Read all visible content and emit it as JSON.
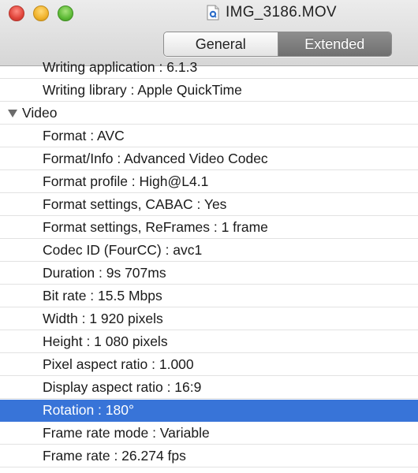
{
  "window": {
    "title": "IMG_3186.MOV",
    "file_icon": "quicktime-document-icon"
  },
  "tabs": {
    "general_label": "General",
    "extended_label": "Extended",
    "selected": "Extended"
  },
  "rows": [
    {
      "kind": "prop",
      "text": "Writing application : 6.1.3"
    },
    {
      "kind": "prop",
      "text": "Writing library : Apple QuickTime"
    },
    {
      "kind": "section",
      "text": "Video"
    },
    {
      "kind": "prop",
      "text": "Format : AVC"
    },
    {
      "kind": "prop",
      "text": "Format/Info : Advanced Video Codec"
    },
    {
      "kind": "prop",
      "text": "Format profile : High@L4.1"
    },
    {
      "kind": "prop",
      "text": "Format settings, CABAC : Yes"
    },
    {
      "kind": "prop",
      "text": "Format settings, ReFrames : 1 frame"
    },
    {
      "kind": "prop",
      "text": "Codec ID (FourCC) : avc1"
    },
    {
      "kind": "prop",
      "text": "Duration : 9s 707ms"
    },
    {
      "kind": "prop",
      "text": "Bit rate : 15.5 Mbps"
    },
    {
      "kind": "prop",
      "text": "Width : 1 920 pixels"
    },
    {
      "kind": "prop",
      "text": "Height : 1 080 pixels"
    },
    {
      "kind": "prop",
      "text": "Pixel aspect ratio : 1.000"
    },
    {
      "kind": "prop",
      "text": "Display aspect ratio : 16:9"
    },
    {
      "kind": "prop",
      "text": "Rotation : 180°",
      "selected": true
    },
    {
      "kind": "prop",
      "text": "Frame rate mode : Variable"
    },
    {
      "kind": "prop",
      "text": "Frame rate : 26.274 fps"
    }
  ],
  "colors": {
    "selection": "#3874d8",
    "extended_tab": "#7a7a7a"
  }
}
